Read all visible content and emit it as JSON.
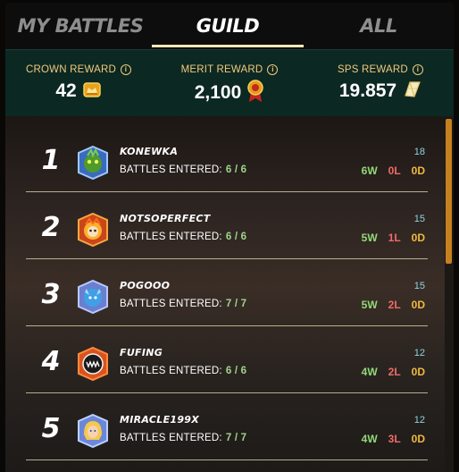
{
  "tabs": [
    {
      "label": "MY BATTLES",
      "active": false
    },
    {
      "label": "GUILD",
      "active": true
    },
    {
      "label": "ALL",
      "active": false
    }
  ],
  "rewards": {
    "crown": {
      "label": "CROWN REWARD",
      "value": "42",
      "icon": "crown-token-icon"
    },
    "merit": {
      "label": "MERIT REWARD",
      "value": "2,100",
      "icon": "merit-medal-icon"
    },
    "sps": {
      "label": "SPS REWARD",
      "value": "19.857",
      "icon": "sps-token-icon"
    },
    "info_glyph": "i"
  },
  "battles_label": "BATTLES ENTERED:",
  "players": [
    {
      "rank": "1",
      "name": "KONEWKA",
      "battles": "6 / 6",
      "points": "18",
      "wins": "6W",
      "losses": "0L",
      "draws": "0D",
      "avatar": "green-creature-avatar-icon"
    },
    {
      "rank": "2",
      "name": "NOTSOPERFECT",
      "battles": "6 / 6",
      "points": "15",
      "wins": "5W",
      "losses": "1L",
      "draws": "0D",
      "avatar": "fire-creature-avatar-icon"
    },
    {
      "rank": "3",
      "name": "POGOOO",
      "battles": "7 / 7",
      "points": "15",
      "wins": "5W",
      "losses": "2L",
      "draws": "0D",
      "avatar": "blue-creature-avatar-icon"
    },
    {
      "rank": "4",
      "name": "FUFING",
      "battles": "6 / 6",
      "points": "12",
      "wins": "4W",
      "losses": "2L",
      "draws": "0D",
      "avatar": "dark-monster-avatar-icon"
    },
    {
      "rank": "5",
      "name": "MIRACLE199X",
      "battles": "7 / 7",
      "points": "12",
      "wins": "4W",
      "losses": "3L",
      "draws": "0D",
      "avatar": "blonde-hero-avatar-icon"
    }
  ],
  "colors": {
    "accent": "#f2e7b5",
    "reward_bg": "#0c2822",
    "win": "#93d878",
    "loss": "#ef6a6a",
    "draw": "#f0b93e",
    "points": "#8ed6e0"
  }
}
